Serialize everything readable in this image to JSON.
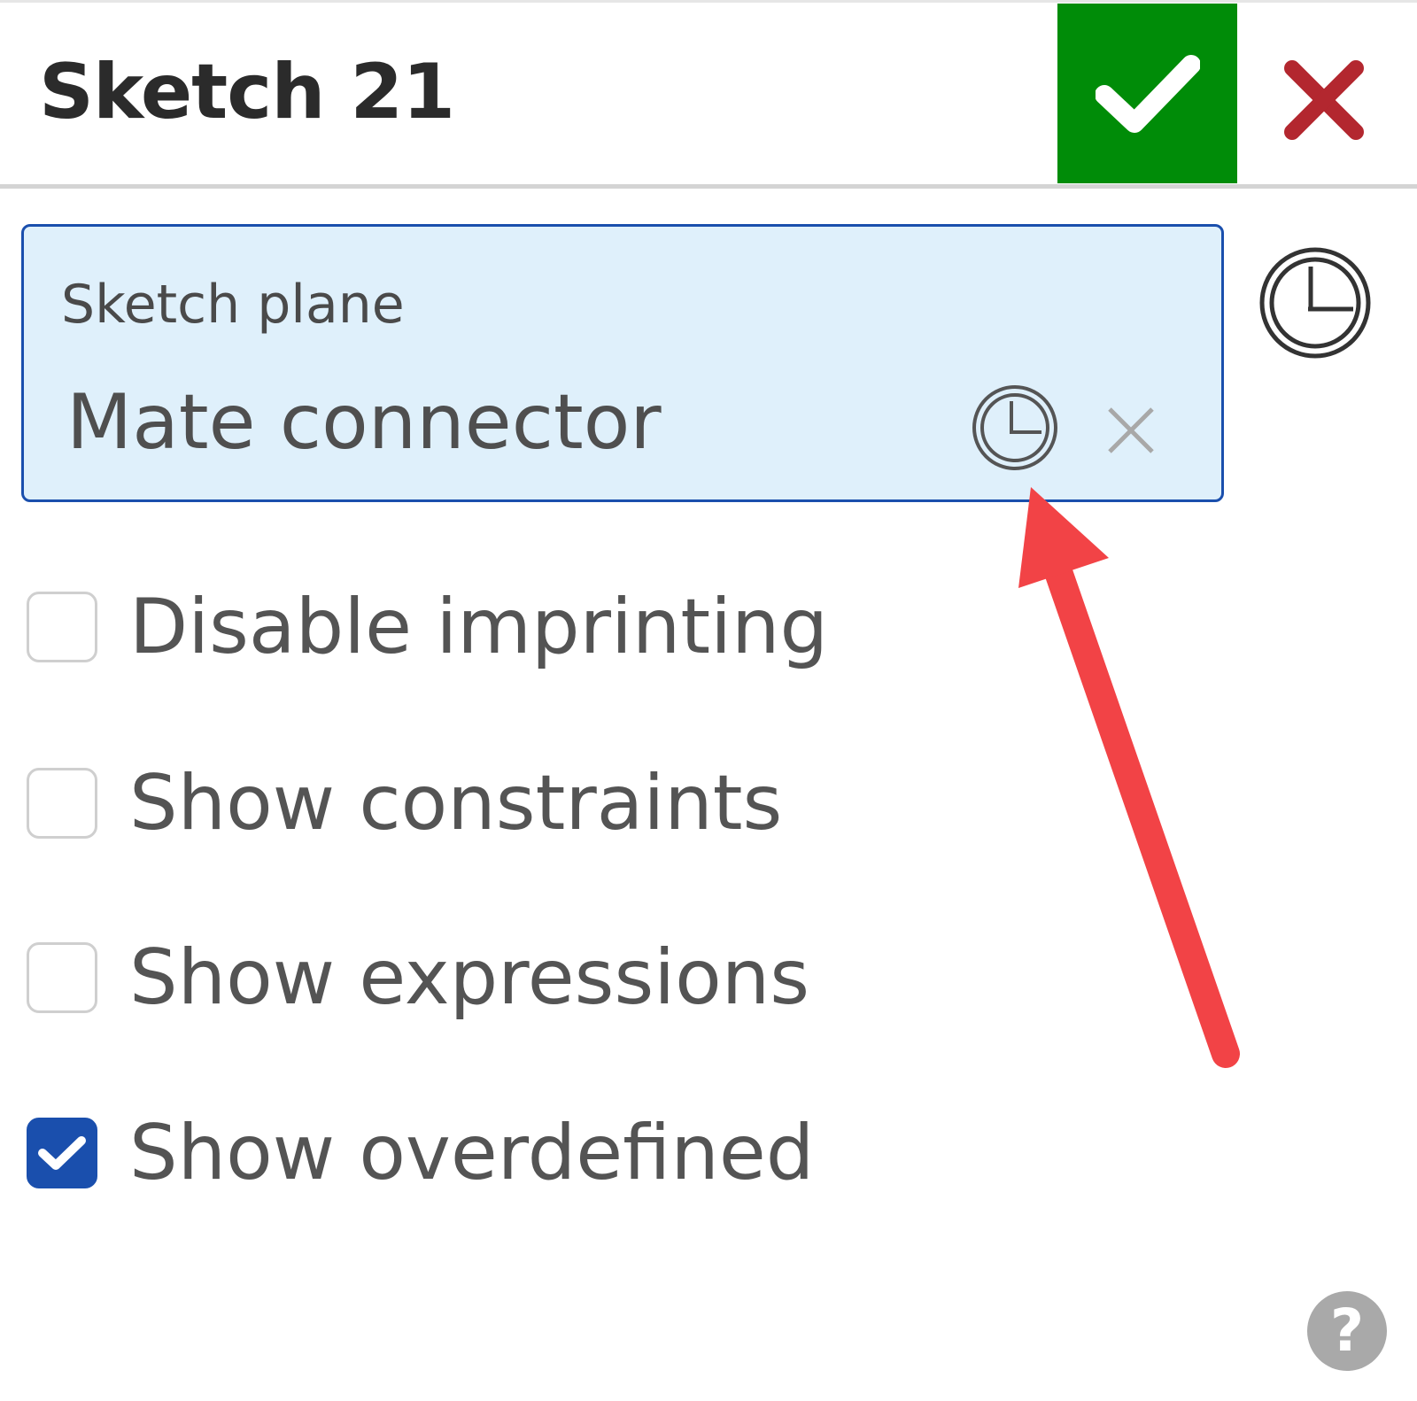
{
  "header": {
    "title": "Sketch 21",
    "accept_icon": "checkmark-icon",
    "cancel_icon": "close-icon",
    "accept_color": "#008c08",
    "cancel_color": "#b3272f"
  },
  "sketch_plane": {
    "label": "Sketch plane",
    "value": "Mate connector",
    "history_icon": "clock-icon",
    "clear_icon": "close-icon",
    "background_color": "#dff0fb",
    "border_color": "#1a4fad"
  },
  "options": [
    {
      "label": "Disable imprinting",
      "checked": false
    },
    {
      "label": "Show constraints",
      "checked": false
    },
    {
      "label": "Show expressions",
      "checked": false
    },
    {
      "label": "Show overdefined",
      "checked": true
    }
  ],
  "help": {
    "icon": "help-icon",
    "glyph": "?"
  },
  "annotation": {
    "type": "arrow",
    "color": "#f24346"
  }
}
